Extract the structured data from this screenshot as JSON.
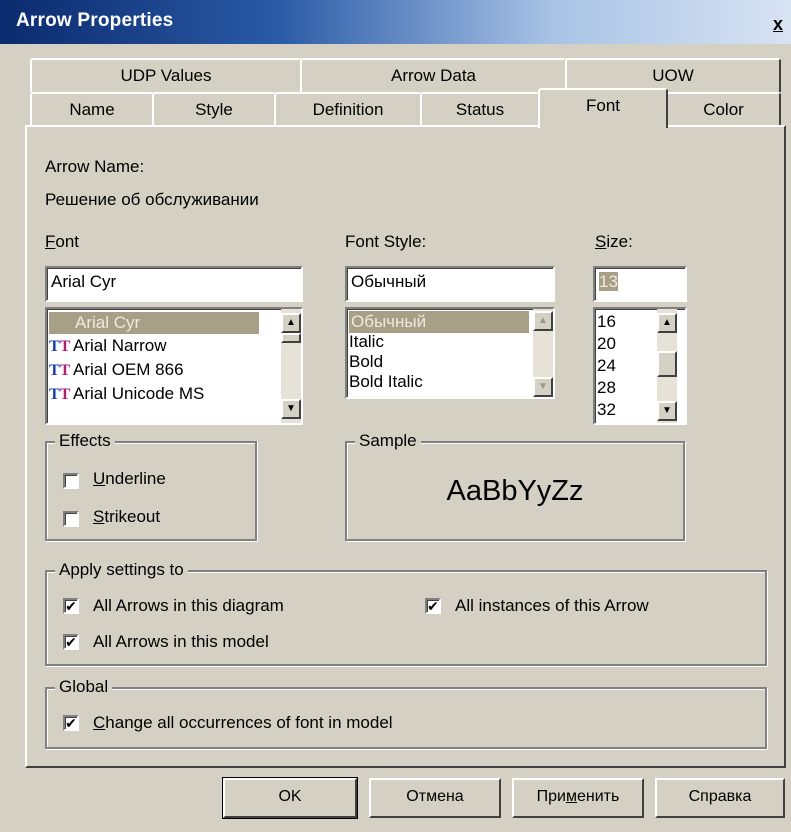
{
  "window": {
    "title": "Arrow Properties",
    "close": "x"
  },
  "tabs_back": [
    "UDP Values",
    "Arrow Data",
    "UOW"
  ],
  "tabs_front": [
    "Name",
    "Style",
    "Definition",
    "Status",
    "Font",
    "Color"
  ],
  "active_tab": "Font",
  "arrow_name": {
    "label": "Arrow Name:",
    "value": "Решение об обслуживании"
  },
  "font": {
    "label_first": "F",
    "label_rest": "ont",
    "value": "Arial Cyr",
    "items": [
      "Arial Cyr",
      "Arial Narrow",
      "Arial OEM 866",
      "Arial Unicode MS"
    ],
    "icon": "truetype-icon"
  },
  "font_style": {
    "label": "Font Style:",
    "value": "Обычный",
    "items": [
      "Обычный",
      "Italic",
      "Bold",
      "Bold Italic"
    ]
  },
  "size": {
    "label_first": "S",
    "label_rest": "ize:",
    "value": "13",
    "items": [
      "16",
      "20",
      "24",
      "28",
      "32"
    ]
  },
  "effects": {
    "title": "Effects",
    "underline_first": "U",
    "underline_rest": "nderline",
    "strikeout_first": "S",
    "strikeout_rest": "trikeout"
  },
  "sample": {
    "title": "Sample",
    "text": "AaBbYyZz"
  },
  "apply": {
    "title": "Apply settings to",
    "all_arrows_diagram": "All Arrows in this diagram",
    "all_instances": "All instances of this Arrow",
    "all_arrows_model": "All Arrows in this model"
  },
  "global": {
    "title": "Global",
    "change_first": "C",
    "change_rest": "hange all occurrences of font in model"
  },
  "buttons": {
    "ok": "OK",
    "cancel": "Отмена",
    "apply_first": "При",
    "apply_u": "м",
    "apply_rest": "енить",
    "help": "Справка"
  }
}
